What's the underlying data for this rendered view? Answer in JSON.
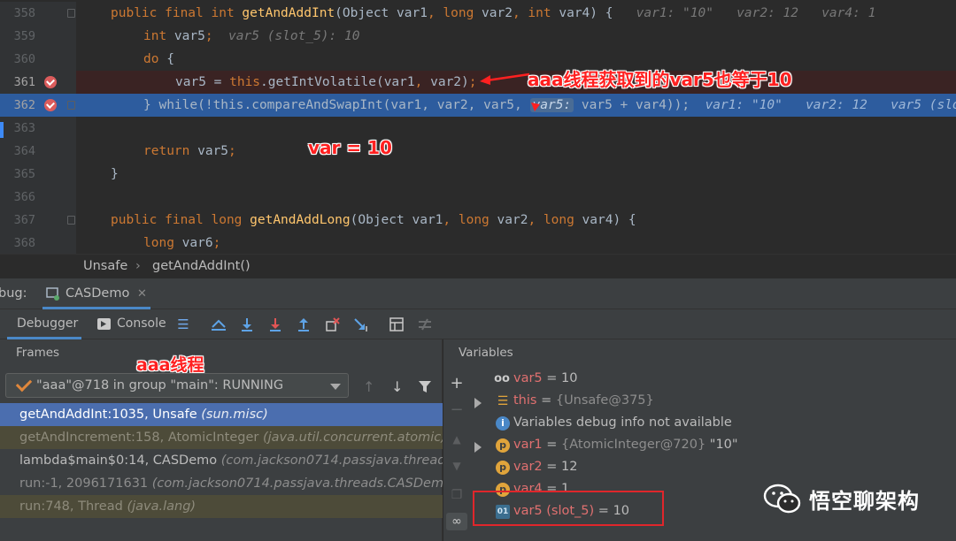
{
  "editor": {
    "lines": [
      {
        "no": "358",
        "code": "public final int getAndAddInt(Object var1, long var2, int var4) {",
        "hint": "var1: \"10\"   var2: 12   var4: 1"
      },
      {
        "no": "359",
        "code": "int var5;",
        "hint": "var5 (slot_5): 10"
      },
      {
        "no": "360",
        "code": "do {"
      },
      {
        "no": "361",
        "code": "var5 = this.getIntVolatile(var1, var2);"
      },
      {
        "no": "362",
        "code_a": "} while(!this.compareAndSwapInt(var1, var2, var5, ",
        "inlay": "var5:",
        "code_b": " var5 + var4));",
        "hint": "var1: \"10\"   var2: 12   var5 (slo"
      },
      {
        "no": "363"
      },
      {
        "no": "364",
        "code": "return var5;"
      },
      {
        "no": "365",
        "code": "}"
      },
      {
        "no": "366"
      },
      {
        "no": "367",
        "code": "public final long getAndAddLong(Object var1, long var2, long var4) {"
      },
      {
        "no": "368",
        "code": "long var6;"
      }
    ]
  },
  "annotations": {
    "arrow_note": "aaa线程获取到的var5也等于10",
    "var_note": "var = 10",
    "frames_note": "aaa线程"
  },
  "breadcrumb": {
    "class": "Unsafe",
    "method": "getAndAddInt()"
  },
  "debug_tab": {
    "prefix": "bug:",
    "config": "CASDemo"
  },
  "toolbar": {
    "debugger": "Debugger",
    "console": "Console"
  },
  "frames": {
    "title": "Frames",
    "thread": "\"aaa\"@718 in group \"main\": RUNNING",
    "rows": [
      {
        "method": "getAndAddInt:1035, Unsafe",
        "pkg": "(sun.misc)"
      },
      {
        "method": "getAndIncrement:158, AtomicInteger",
        "pkg": "(java.util.concurrent.atomic)"
      },
      {
        "method": "lambda$main$0:14, CASDemo",
        "pkg": "(com.jackson0714.passjava.threads)"
      },
      {
        "method": "run:-1, 2096171631",
        "pkg": "(com.jackson0714.passjava.threads.CASDemo$"
      },
      {
        "method": "run:748, Thread",
        "pkg": "(java.lang)"
      }
    ]
  },
  "variables": {
    "title": "Variables",
    "rows": [
      {
        "name": "var5",
        "eq": " = ",
        "value": "10"
      },
      {
        "name": "this",
        "eq": " = ",
        "value": "{Unsafe@375}"
      },
      {
        "name": "Variables debug info not available"
      },
      {
        "name": "var1",
        "eq": " = ",
        "value": "{AtomicInteger@720}",
        "value2": " \"10\""
      },
      {
        "name": "var2",
        "eq": " = ",
        "value": "12"
      },
      {
        "name": "var4",
        "eq": " = ",
        "value": "1"
      },
      {
        "name": "var5 (slot_5)",
        "eq": " = ",
        "value": "10"
      }
    ]
  },
  "watermark": "悟空聊架构"
}
